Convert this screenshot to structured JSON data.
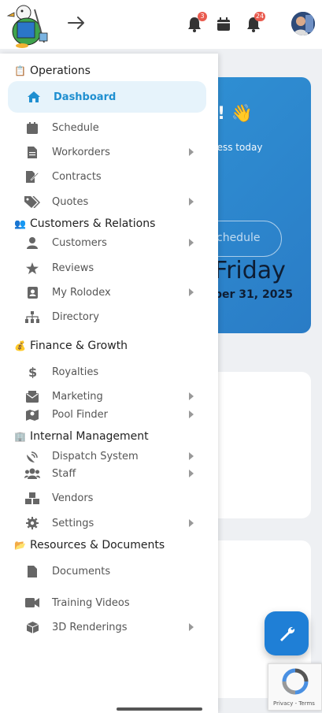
{
  "topbar": {
    "notification_count_1": "3",
    "notification_count_2": "24"
  },
  "hero": {
    "greeting_suffix": "! 👋",
    "subtitle": "ness today",
    "button_label": "chedule",
    "day": "Friday",
    "date": "ber 31, 2025"
  },
  "sidebar": {
    "sections": [
      {
        "emoji": "📋",
        "label": "Operations"
      },
      {
        "emoji": "👥",
        "label": "Customers & Relations"
      },
      {
        "emoji": "💰",
        "label": "Finance & Growth"
      },
      {
        "emoji": "🏢",
        "label": "Internal Management"
      },
      {
        "emoji": "📂",
        "label": "Resources & Documents"
      }
    ],
    "items": [
      {
        "label": "Dashboard",
        "icon": "home-icon"
      },
      {
        "label": "Schedule",
        "icon": "calendar-icon"
      },
      {
        "label": "Workorders",
        "icon": "file-icon"
      },
      {
        "label": "Contracts",
        "icon": "file-signature-icon"
      },
      {
        "label": "Quotes",
        "icon": "tags-icon"
      },
      {
        "label": "Customers",
        "icon": "user-icon"
      },
      {
        "label": "Reviews",
        "icon": "star-icon"
      },
      {
        "label": "My Rolodex",
        "icon": "address-book-icon"
      },
      {
        "label": "Directory",
        "icon": "sitemap-icon"
      },
      {
        "label": "Royalties",
        "icon": "dollar-icon"
      },
      {
        "label": "Marketing",
        "icon": "mail-bulk-icon"
      },
      {
        "label": "Pool Finder",
        "icon": "map-marker-icon"
      },
      {
        "label": "Dispatch System",
        "icon": "satellite-dish-icon"
      },
      {
        "label": "Staff",
        "icon": "users-icon"
      },
      {
        "label": "Vendors",
        "icon": "boxes-icon"
      },
      {
        "label": "Settings",
        "icon": "gear-icon"
      },
      {
        "label": "Documents",
        "icon": "document-icon"
      },
      {
        "label": "Training Videos",
        "icon": "video-icon"
      },
      {
        "label": "3D Renderings",
        "icon": "cube-icon"
      }
    ]
  },
  "recaptcha": {
    "text": "Privacy - Terms"
  },
  "colors": {
    "accent": "#1f8fd0",
    "active_bg": "#e6f3fb",
    "badge": "#e95b4f"
  }
}
